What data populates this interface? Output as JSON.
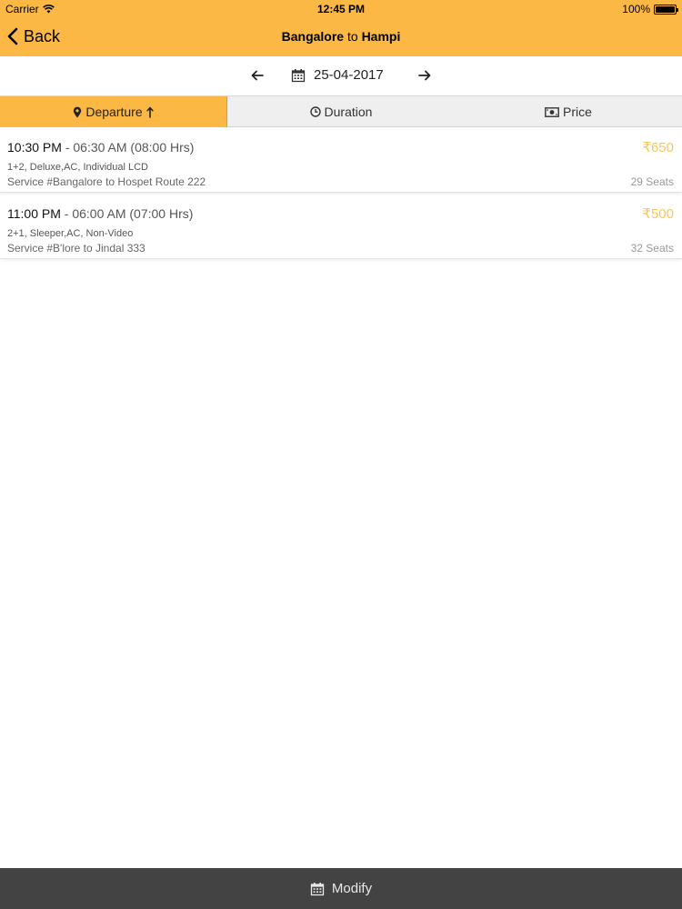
{
  "status_bar": {
    "carrier": "Carrier",
    "time": "12:45 PM",
    "battery": "100%"
  },
  "nav": {
    "back_label": "Back",
    "title_from": "Bangalore",
    "title_sep": "to",
    "title_to": "Hampi"
  },
  "date_nav": {
    "date": "25-04-2017"
  },
  "tabs": [
    {
      "label": "Departure",
      "active": true,
      "icon": "map-pin-icon"
    },
    {
      "label": "Duration",
      "active": false,
      "icon": "clock-icon"
    },
    {
      "label": "Price",
      "active": false,
      "icon": "money-icon"
    }
  ],
  "buses": [
    {
      "departure": "10:30 PM",
      "arrival_duration": "06:30 AM (08:00 Hrs)",
      "type": "1+2, Deluxe,AC, Individual LCD",
      "service": "Service #Bangalore to Hospet Route 222",
      "price": "₹650",
      "seats": "29 Seats"
    },
    {
      "departure": "11:00 PM",
      "arrival_duration": "06:00 AM (07:00 Hrs)",
      "type": "2+1, Sleeper,AC, Non-Video",
      "service": "Service #B'lore to Jindal 333",
      "price": "₹500",
      "seats": "32 Seats"
    }
  ],
  "bottom": {
    "modify_label": "Modify"
  },
  "colors": {
    "accent": "#fbb844",
    "price": "#f6c65a",
    "bottom_bar": "#434343"
  }
}
